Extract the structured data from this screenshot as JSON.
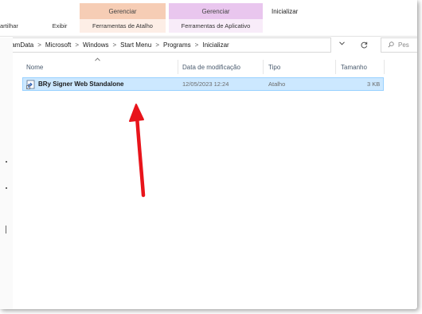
{
  "ribbon": {
    "partial_left_tab": "artilhar",
    "view_tab": "Exibir",
    "context_group_1": {
      "title": "Gerenciar",
      "tab": "Ferramentas de Atalho",
      "color": "#f6cdb5"
    },
    "context_group_2": {
      "title": "Gerenciar",
      "tab": "Ferramentas de Aplicativo",
      "color": "#e9c6ee"
    },
    "active_tab": "Inicializar"
  },
  "address_bar": {
    "breadcrumbs": [
      "rogramData",
      "Microsoft",
      "Windows",
      "Start Menu",
      "Programs",
      "Inicializar"
    ],
    "separator": ">"
  },
  "search": {
    "placeholder": "Pes"
  },
  "columns": {
    "name": "Nome",
    "modified": "Data de modificação",
    "type": "Tipo",
    "size": "Tamanho"
  },
  "files": [
    {
      "name": "BRy Signer Web Standalone",
      "modified": "12/05/2023 12:24",
      "type": "Atalho",
      "size": "3 KB",
      "selected": true,
      "icon": "shortcut-icon"
    }
  ],
  "colors": {
    "selection_bg": "#cce8ff",
    "selection_border": "#99d1ff",
    "annotation_arrow": "#e8141b"
  }
}
